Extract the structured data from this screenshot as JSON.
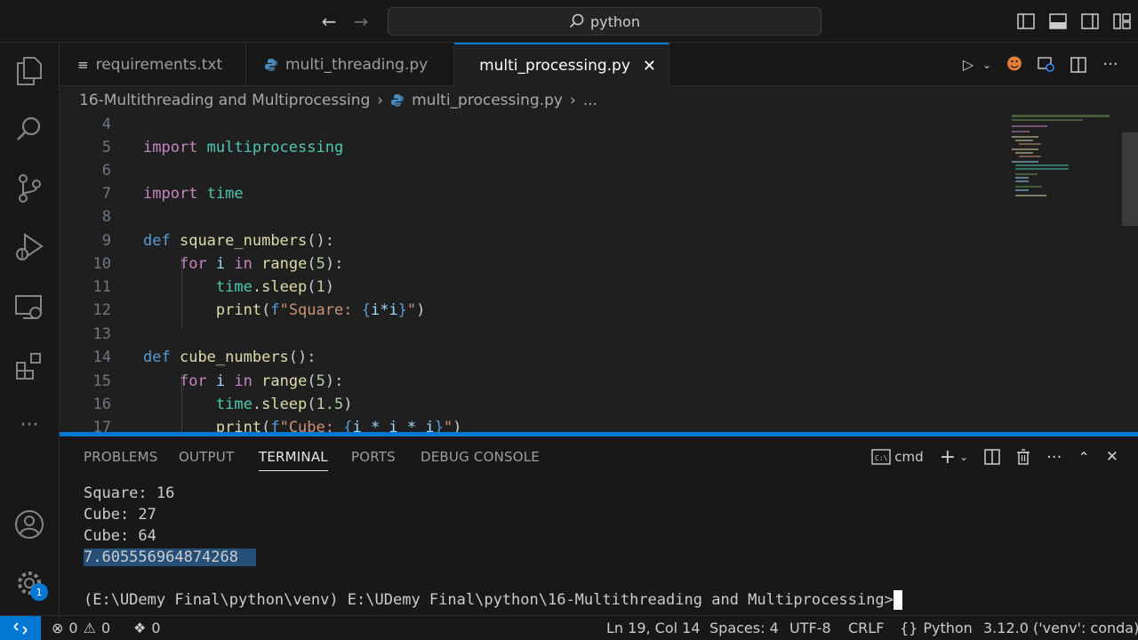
{
  "titlebar": {
    "search_text": "python"
  },
  "tabs": [
    {
      "label": "requirements.txt",
      "icon": "text-file-icon",
      "active": false
    },
    {
      "label": "multi_threading.py",
      "icon": "python-icon",
      "active": false
    },
    {
      "label": "multi_processing.py",
      "icon": "python-icon",
      "active": true
    }
  ],
  "breadcrumb": {
    "folder": "16-Multithreading and Multiprocessing",
    "file": "multi_processing.py",
    "more": "..."
  },
  "editor": {
    "line_numbers": [
      "4",
      "5",
      "6",
      "7",
      "8",
      "9",
      "10",
      "11",
      "12",
      "13",
      "14",
      "15",
      "16",
      "17"
    ],
    "lines": {
      "l5": {
        "kw": "import",
        "mod": "multiprocessing"
      },
      "l7": {
        "kw": "import",
        "mod": "time"
      },
      "l9": {
        "kw": "def",
        "fn": "square_numbers",
        "rest": "():"
      },
      "l10": {
        "kw": "for",
        "var": "i",
        "kw_in": "in",
        "fn": "range",
        "open": "(",
        "num": "5",
        "close": "):"
      },
      "l11": {
        "mod": "time",
        "dot": ".",
        "fn": "sleep",
        "open": "(",
        "num": "1",
        "close": ")"
      },
      "l12": {
        "fn": "print",
        "open": "(",
        "prefix": "f",
        "str1": "\"Square: ",
        "brace_open": "{",
        "expr": "i*i",
        "brace_close": "}",
        "str2": "\"",
        "close": ")"
      },
      "l14": {
        "kw": "def",
        "fn": "cube_numbers",
        "rest": "():"
      },
      "l15": {
        "kw": "for",
        "var": "i",
        "kw_in": "in",
        "fn": "range",
        "open": "(",
        "num": "5",
        "close": "):"
      },
      "l16": {
        "mod": "time",
        "dot": ".",
        "fn": "sleep",
        "open": "(",
        "num": "1.5",
        "close": ")"
      },
      "l17": {
        "fn": "print",
        "open": "(",
        "prefix": "f",
        "str1": "\"Cube: ",
        "brace_open": "{",
        "expr": "i * i * i",
        "brace_close": "}",
        "str2": "\"",
        "close": ")"
      }
    }
  },
  "panel": {
    "tabs": [
      "PROBLEMS",
      "OUTPUT",
      "TERMINAL",
      "PORTS",
      "DEBUG CONSOLE"
    ],
    "active_tab": "TERMINAL",
    "shell": "cmd",
    "terminal_lines": [
      "Square: 16",
      "Cube: 27",
      "Cube: 64"
    ],
    "selected_line": "7.605556964874268",
    "prompt": "(E:\\UDemy Final\\python\\venv) E:\\UDemy Final\\python\\16-Multithreading and Multiprocessing>"
  },
  "statusbar": {
    "errors": "0",
    "warnings": "0",
    "ports": "0",
    "position": "Ln 19, Col 14",
    "spaces": "Spaces: 4",
    "encoding": "UTF-8",
    "eol": "CRLF",
    "language": "Python",
    "interpreter": "3.12.0 ('venv': conda)"
  },
  "activity": {
    "settings_badge": "1"
  },
  "colors": {
    "accent": "#0078d4",
    "background": "#1f1f1f",
    "chrome": "#181818",
    "selection": "#264f78"
  }
}
